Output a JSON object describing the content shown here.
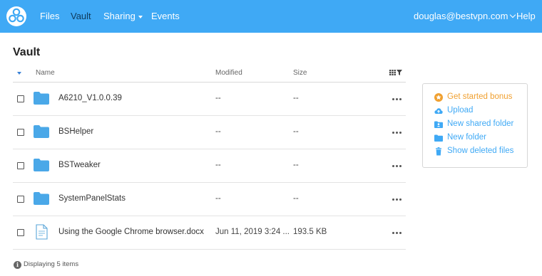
{
  "nav": {
    "items": [
      {
        "label": "Files"
      },
      {
        "label": "Vault"
      },
      {
        "label": "Sharing"
      },
      {
        "label": "Events"
      }
    ],
    "user": "douglas@bestvpn.com",
    "help": "Help"
  },
  "page": {
    "title": "Vault"
  },
  "table": {
    "headers": {
      "name": "Name",
      "modified": "Modified",
      "size": "Size"
    },
    "rows": [
      {
        "type": "folder",
        "name": "A6210_V1.0.0.39",
        "modified": "--",
        "size": "--"
      },
      {
        "type": "folder",
        "name": "BSHelper",
        "modified": "--",
        "size": "--"
      },
      {
        "type": "folder",
        "name": "BSTweaker",
        "modified": "--",
        "size": "--"
      },
      {
        "type": "folder",
        "name": "SystemPanelStats",
        "modified": "--",
        "size": "--"
      },
      {
        "type": "document",
        "name": "Using the Google Chrome browser.docx",
        "modified": "Jun 11, 2019 3:24 ...",
        "size": "193.5 KB"
      }
    ]
  },
  "footer": {
    "status": "Displaying 5 items"
  },
  "side_panel": {
    "items": [
      {
        "label": "Get started bonus",
        "icon": "star-icon"
      },
      {
        "label": "Upload",
        "icon": "cloud-upload-icon"
      },
      {
        "label": "New shared folder",
        "icon": "shared-folder-icon"
      },
      {
        "label": "New folder",
        "icon": "folder-icon"
      },
      {
        "label": "Show deleted files",
        "icon": "trash-icon"
      }
    ]
  },
  "colors": {
    "brand": "#3fa9f5",
    "nav_active": "#0f3b5c",
    "bonus": "#f0a030",
    "folder": "#4aa8e8"
  }
}
